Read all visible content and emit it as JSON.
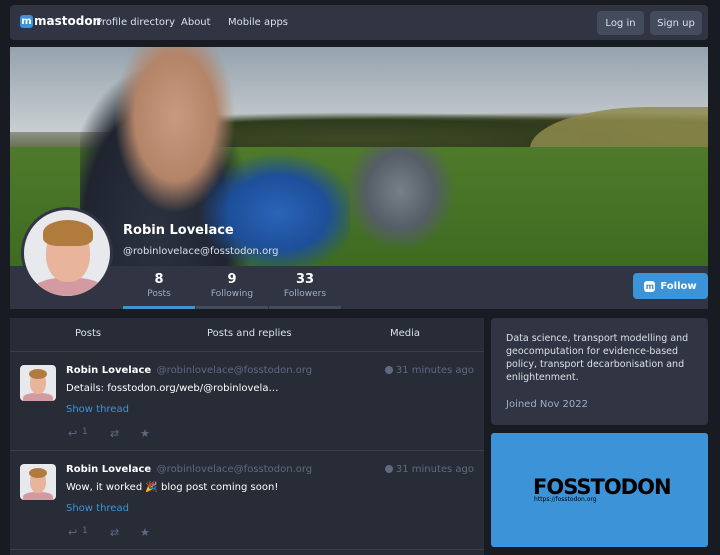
{
  "nav": {
    "logo_text": "mastodon",
    "links": [
      "Profile directory",
      "About",
      "Mobile apps"
    ],
    "login": "Log in",
    "signup": "Sign up"
  },
  "profile": {
    "name": "Robin Lovelace",
    "handle": "@robinlovelace@fosstodon.org",
    "stats": [
      {
        "value": "8",
        "label": "Posts"
      },
      {
        "value": "9",
        "label": "Following"
      },
      {
        "value": "33",
        "label": "Followers"
      }
    ],
    "follow_label": "Follow"
  },
  "timeline": {
    "tabs": [
      "Posts",
      "Posts and replies",
      "Media"
    ],
    "statuses": [
      {
        "name": "Robin Lovelace",
        "acct": "@robinlovelace@fosstodon.org",
        "time": "31 minutes ago",
        "text": "Details: fosstodon.org/web/@robinlovela…",
        "thread": "Show thread",
        "replies": "1"
      },
      {
        "name": "Robin Lovelace",
        "acct": "@robinlovelace@fosstodon.org",
        "time": "31 minutes ago",
        "text": "Wow, it worked 🎉 blog post coming soon!",
        "thread": "Show thread",
        "replies": "1"
      }
    ]
  },
  "sidebar": {
    "bio": "Data science, transport modelling and geocomputation for evidence-based policy, transport decarbonisation and enlightenment.",
    "joined": "Joined Nov 2022",
    "promo_logo": "FOSSTODON",
    "promo_url": "https://fosstodon.org"
  },
  "colors": {
    "accent": "#3c93d7",
    "background": "#191b22",
    "panel": "#282c37"
  }
}
